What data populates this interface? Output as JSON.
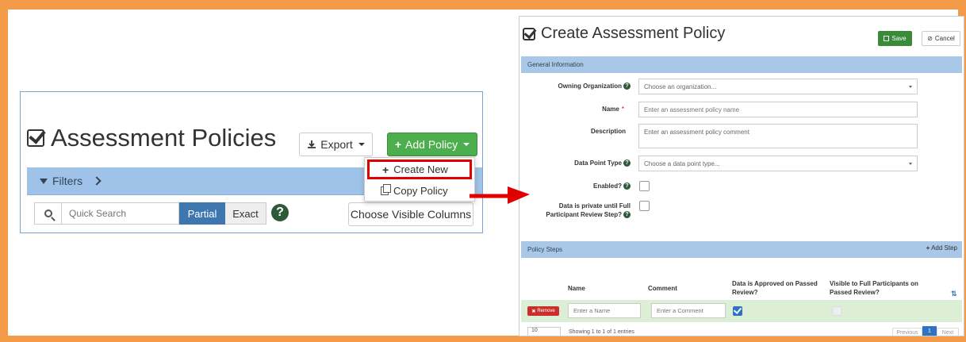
{
  "left": {
    "title": "Assessment Policies",
    "export_label": "Export",
    "add_policy_label": "Add Policy",
    "filters_label": "Filters",
    "quick_search_placeholder": "Quick Search",
    "partial_label": "Partial",
    "exact_label": "Exact",
    "help_glyph": "?",
    "choose_columns_label": "Choose Visible Columns",
    "dropdown": {
      "create_new": "Create New",
      "copy_policy": "Copy Policy"
    }
  },
  "right": {
    "title": "Create Assessment Policy",
    "save_label": "Save",
    "cancel_label": "Cancel",
    "general_info_header": "General Information",
    "fields": {
      "owning_org_label": "Owning Organization",
      "owning_org_placeholder": "Choose an organization...",
      "name_label": "Name",
      "name_required": "*",
      "name_placeholder": "Enter an assessment policy name",
      "description_label": "Description",
      "description_placeholder": "Enter an assessment policy comment",
      "data_point_type_label": "Data Point Type",
      "data_point_type_placeholder": "Choose a data point type...",
      "enabled_label": "Enabled?",
      "private_label_line1": "Data is private until Full",
      "private_label_line2": "Participant Review Step?"
    },
    "policy_steps_header": "Policy Steps",
    "add_step_label": "Add Step",
    "table": {
      "col_name": "Name",
      "col_comment": "Comment",
      "col_approved_line1": "Data is Approved on Passed",
      "col_approved_line2": "Review?",
      "col_visible_line1": "Visible to Full Participants on",
      "col_visible_line2": "Passed Review?",
      "remove_label": "Remove",
      "name_placeholder": "Enter a Name",
      "comment_placeholder": "Enter a Comment",
      "approved_checked": true,
      "visible_checked": false
    },
    "pager": {
      "page_size": "10",
      "showing_text": "Showing 1 to 1 of 1 entries",
      "prev_label": "Previous",
      "current_page": "1",
      "next_label": "Next"
    }
  },
  "colors": {
    "frame": "#f39a48",
    "success": "#4cae4c",
    "primary": "#3e76b0",
    "header_bg": "#9fc3e8",
    "highlight": "#e00000",
    "danger": "#c9302c",
    "row_bg": "#dcefd6"
  },
  "icons": [
    "checkbox-square-icon",
    "download-icon",
    "plus-icon",
    "filter-icon",
    "chevron-right-icon",
    "search-icon",
    "help-icon",
    "copy-icon",
    "arrow-right-icon",
    "save-icon",
    "cancel-icon",
    "sort-icon"
  ]
}
